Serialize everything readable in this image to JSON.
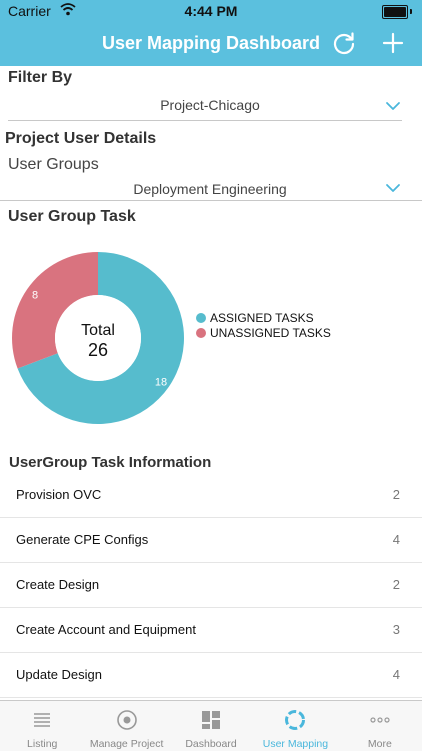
{
  "status_bar": {
    "carrier": "Carrier",
    "time": "4:44 PM"
  },
  "navbar": {
    "title": "User Mapping Dashboard",
    "refresh_icon": "refresh-icon",
    "add_icon": "plus-icon"
  },
  "filter": {
    "label": "Filter By",
    "selected": "Project-Chicago"
  },
  "project_user_details": {
    "label": "Project User Details",
    "user_groups_label": "User Groups",
    "selected_group": "Deployment Engineering"
  },
  "user_group_task": {
    "label": "User Group Task",
    "total_label": "Total",
    "total_value": "26"
  },
  "chart_data": {
    "type": "pie",
    "categories": [
      "ASSIGNED TASKS",
      "UNASSIGNED TASKS"
    ],
    "values": [
      18,
      8
    ],
    "data_labels": [
      "18",
      "8"
    ],
    "colors": [
      "#56bccd",
      "#d9737f"
    ],
    "center_label": "Total 26",
    "legend_position": "right"
  },
  "task_info": {
    "label": "UserGroup Task Information",
    "rows": [
      {
        "name": "Provision OVC",
        "count": "2"
      },
      {
        "name": "Generate CPE Configs",
        "count": "4"
      },
      {
        "name": "Create Design",
        "count": "2"
      },
      {
        "name": "Create Account and Equipment",
        "count": "3"
      },
      {
        "name": "Update Design",
        "count": "4"
      }
    ]
  },
  "tabbar": {
    "tabs": [
      {
        "label": "Listing",
        "icon": "list-icon",
        "active": false
      },
      {
        "label": "Manage Project",
        "icon": "target-icon",
        "active": false
      },
      {
        "label": "Dashboard",
        "icon": "dashboard-icon",
        "active": false
      },
      {
        "label": "User Mapping",
        "icon": "user-mapping-icon",
        "active": true
      },
      {
        "label": "More",
        "icon": "more-icon",
        "active": false
      }
    ]
  },
  "colors": {
    "accent": "#5bc0de",
    "assigned": "#56bccd",
    "unassigned": "#d9737f",
    "active_tab": "#4ab7dc"
  }
}
